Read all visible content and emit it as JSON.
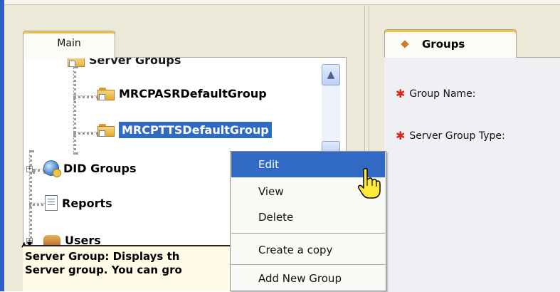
{
  "left_tab": {
    "label": "Main"
  },
  "tree": {
    "top_partial": "Server Groups",
    "nodes": [
      {
        "label": "MRCPASRDefaultGroup"
      },
      {
        "label": "MRCPTTSDefaultGroup"
      },
      {
        "label": "DID Groups"
      },
      {
        "label": "Reports"
      },
      {
        "label": "Users"
      }
    ]
  },
  "description": {
    "line1": "Server Group: Displays th",
    "line2": "Server group. You can gro"
  },
  "right_tab": {
    "label": "Groups"
  },
  "form": {
    "group_name_label": "Group Name:",
    "server_group_type_label": "Server Group Type:"
  },
  "context_menu": {
    "items": [
      {
        "label": "Edit"
      },
      {
        "label": "View"
      },
      {
        "label": "Delete"
      },
      {
        "label": "Create a copy"
      },
      {
        "label": "Add New Group"
      }
    ],
    "highlighted": "Edit"
  }
}
